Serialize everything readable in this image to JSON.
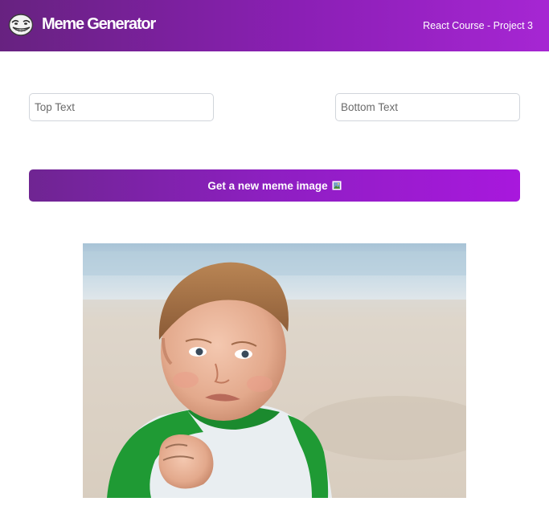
{
  "header": {
    "logo_icon": "troll-face-icon",
    "title": "Meme Generator",
    "project": "React Course - Project 3",
    "gradient_start": "#672280",
    "gradient_end": "#a626d3"
  },
  "form": {
    "top_text_placeholder": "Top Text",
    "top_text_value": "",
    "bottom_text_placeholder": "Bottom Text",
    "bottom_text_value": "",
    "button_label": "Get a new meme image",
    "button_icon": "picture-frame-icon"
  },
  "meme": {
    "image_icon": "success-kid-photo",
    "top_text": "",
    "bottom_text": ""
  }
}
